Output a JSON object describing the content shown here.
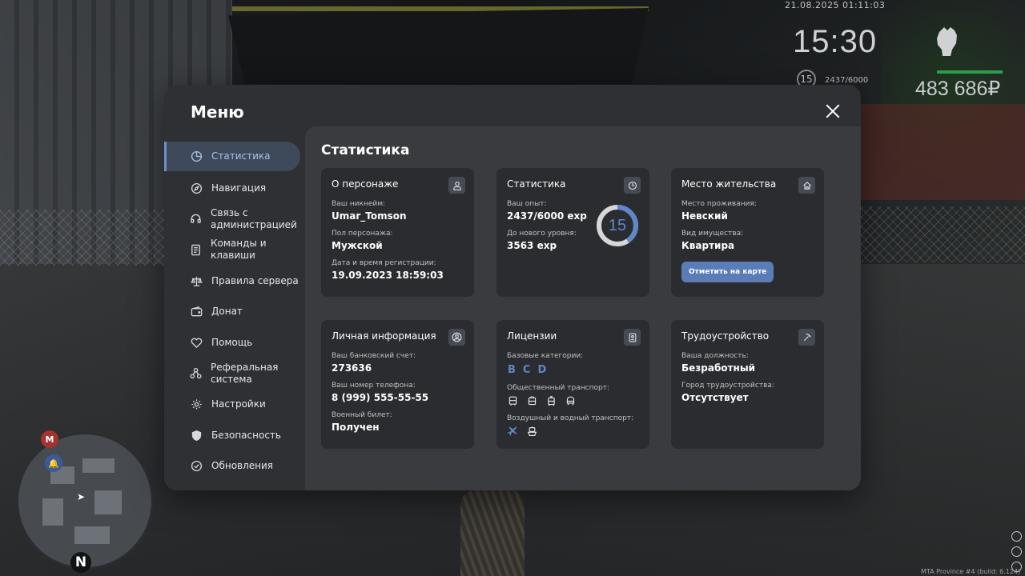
{
  "hud": {
    "datetime": "21.08.2025 01:11:03",
    "time": "15:30",
    "money": "483 686₽",
    "level": "15",
    "exp": "2437/6000",
    "build": "MTA Province #4 (build: 6.124)"
  },
  "minimap": {
    "marker_m": "M",
    "north": "N"
  },
  "menu": {
    "title": "Меню",
    "sidebar": [
      {
        "label": "Статистика",
        "icon": "pie-chart-icon"
      },
      {
        "label": "Навигация",
        "icon": "compass-icon"
      },
      {
        "label": "Связь с администрацией",
        "icon": "headset-icon"
      },
      {
        "label": "Команды и клавиши",
        "icon": "document-icon"
      },
      {
        "label": "Правила сервера",
        "icon": "scales-icon"
      },
      {
        "label": "Донат",
        "icon": "wallet-icon"
      },
      {
        "label": "Помощь",
        "icon": "heart-hands-icon"
      },
      {
        "label": "Реферальная система",
        "icon": "network-icon"
      },
      {
        "label": "Настройки",
        "icon": "gear-icon"
      },
      {
        "label": "Безопасность",
        "icon": "shield-icon"
      },
      {
        "label": "Обновления",
        "icon": "check-circle-icon"
      }
    ],
    "active_index": 0
  },
  "content": {
    "title": "Статистика",
    "character": {
      "title": "О персонаже",
      "nickname_label": "Ваш никнейм:",
      "nickname": "Umar_Tomson",
      "gender_label": "Пол персонажа:",
      "gender": "Мужской",
      "reg_label": "Дата и время регистрации:",
      "reg": "19.09.2023 18:59:03"
    },
    "stats": {
      "title": "Статистика",
      "exp_label": "Ваш опыт:",
      "exp": "2437/6000 exp",
      "next_label": "До нового уровня:",
      "next": "3563 exp",
      "level": "15",
      "progress": 0.406
    },
    "residence": {
      "title": "Место жительства",
      "place_label": "Место проживания:",
      "place": "Невский",
      "property_label": "Вид имущества:",
      "property": "Квартира",
      "button": "Отметить на карте"
    },
    "personal": {
      "title": "Личная информация",
      "bank_label": "Ваш банковский счет:",
      "bank": "273636",
      "phone_label": "Ваш номер телефона:",
      "phone": "8 (999) 555-55-55",
      "military_label": "Военный билет:",
      "military": "Получен"
    },
    "licenses": {
      "title": "Лицензии",
      "base_label": "Базовые категории:",
      "categories": [
        "B",
        "C",
        "D"
      ],
      "public_label": "Общественный транспорт:",
      "air_label": "Воздушный и водный транспорт:"
    },
    "employment": {
      "title": "Трудоустройство",
      "position_label": "Ваша должность:",
      "position": "Безработный",
      "city_label": "Город трудоустройства:",
      "city": "Отсутствует"
    }
  },
  "colors": {
    "accent": "#5f86c9",
    "panel": "#2f3033",
    "card": "#2b2c2f"
  }
}
